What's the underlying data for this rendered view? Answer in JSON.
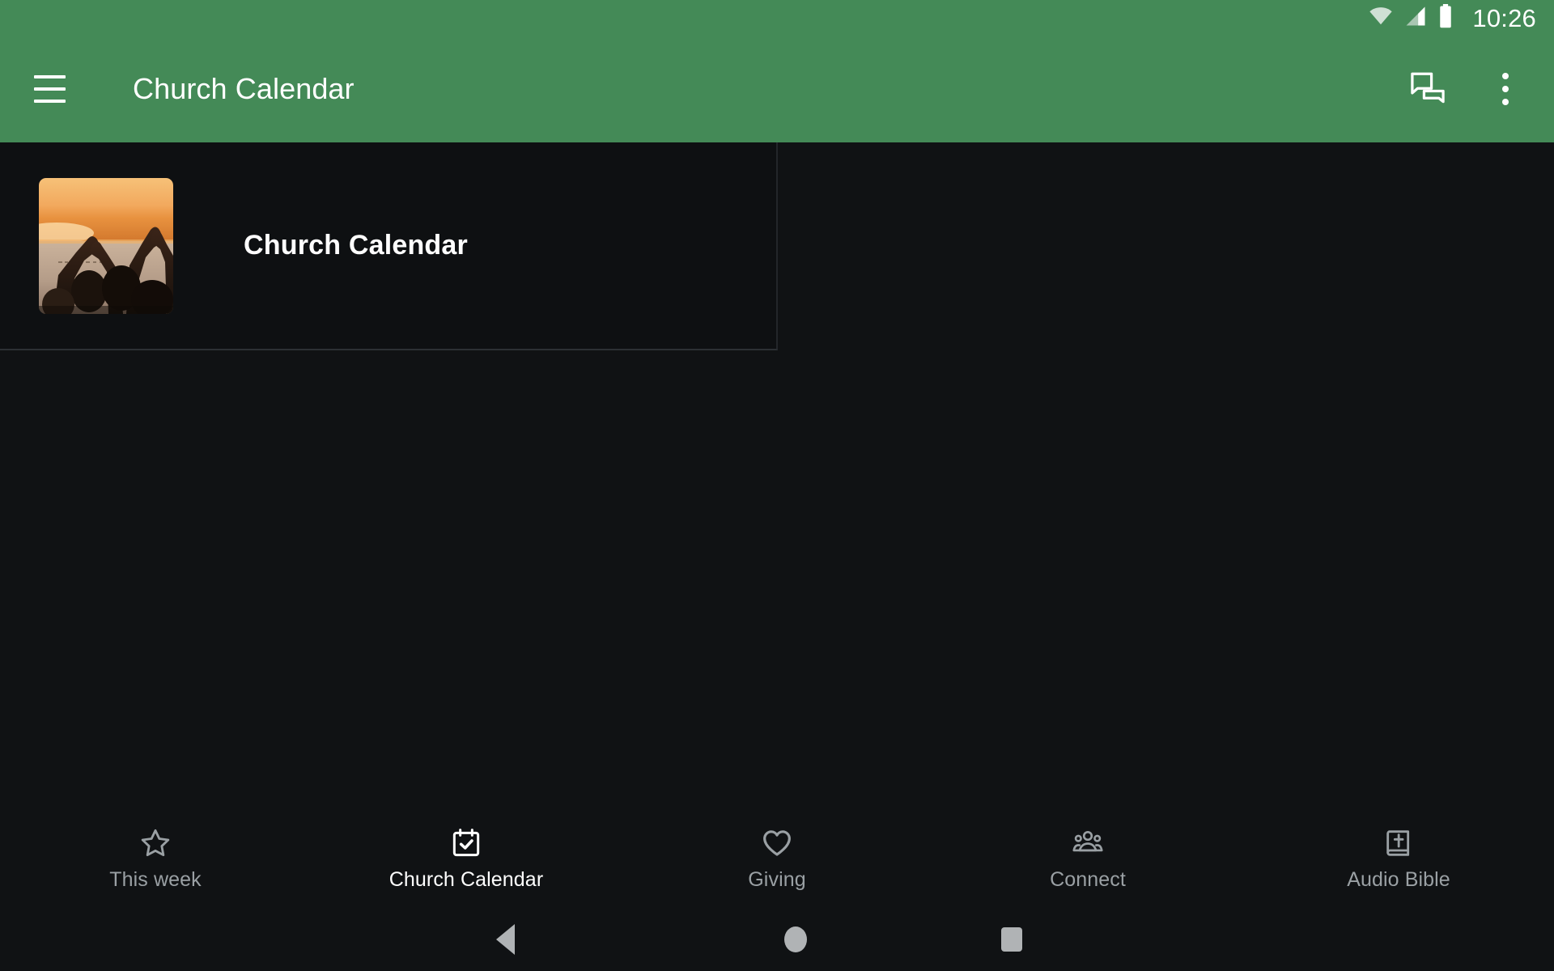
{
  "status_bar": {
    "time": "10:26",
    "icons": [
      "wifi-icon",
      "cell-signal-icon",
      "battery-icon"
    ]
  },
  "app_bar": {
    "title": "Church Calendar",
    "menu_icon": "hamburger-menu-icon",
    "actions": [
      {
        "icon": "chat-bubbles-icon",
        "label": "Messages"
      },
      {
        "icon": "overflow-menu-icon",
        "label": "More options"
      }
    ],
    "background_color": "#448A57"
  },
  "main": {
    "card": {
      "title": "Church Calendar",
      "thumbnail_alt": "Silhouettes of people making heart shapes with hands at sunset over water"
    }
  },
  "bottom_nav": {
    "items": [
      {
        "label": "This week",
        "icon": "star-outline-icon",
        "active": false
      },
      {
        "label": "Church Calendar",
        "icon": "calendar-check-icon",
        "active": true
      },
      {
        "label": "Giving",
        "icon": "heart-outline-icon",
        "active": false
      },
      {
        "label": "Connect",
        "icon": "people-group-icon",
        "active": false
      },
      {
        "label": "Audio Bible",
        "icon": "bible-book-cross-icon",
        "active": false
      }
    ],
    "active_color": "#ffffff",
    "inactive_color": "#9aa0a4"
  },
  "system_nav": {
    "buttons": [
      {
        "name": "back-button",
        "icon": "triangle-back-icon"
      },
      {
        "name": "home-button",
        "icon": "circle-home-icon"
      },
      {
        "name": "recents-button",
        "icon": "square-recents-icon"
      }
    ]
  }
}
